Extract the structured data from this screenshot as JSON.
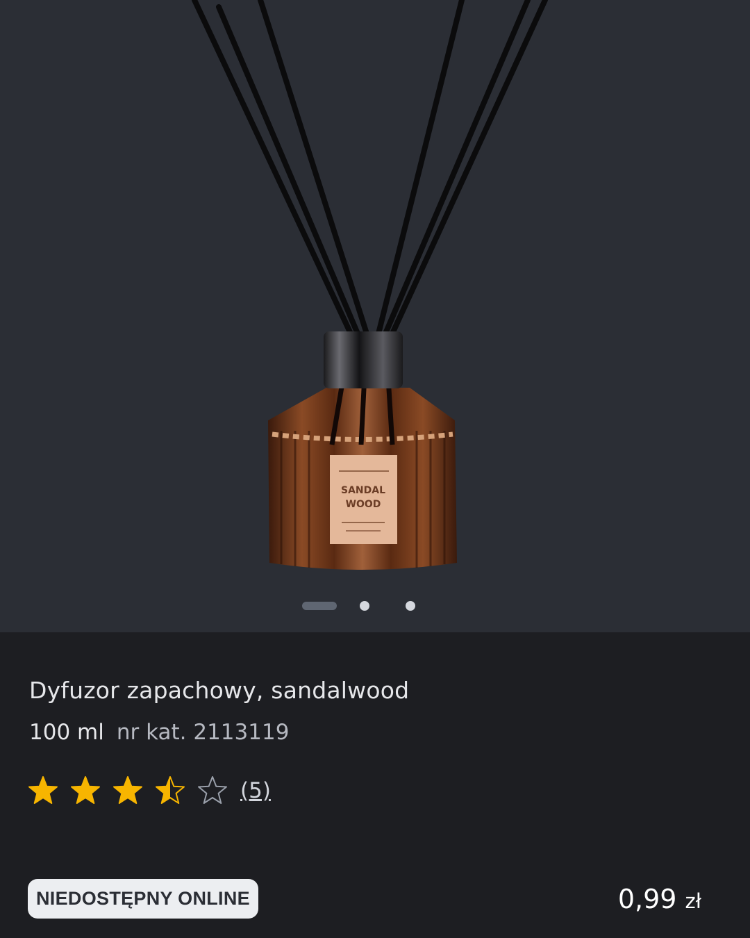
{
  "product": {
    "name": "Dyfuzor zapachowy, sandalwood",
    "size": "100 ml",
    "catalog": "nr kat. 2113119",
    "price_amount": "0,99",
    "price_currency": "zł",
    "availability": "NIEDOSTĘPNY ONLINE"
  },
  "rating": {
    "value": 3.5,
    "max": 5,
    "count": "(5)",
    "star_color": "#f7b500"
  },
  "gallery": {
    "image_count": 3,
    "active_index": 0,
    "image_label": {
      "line1": "SANDAL",
      "line2": "WOOD"
    }
  }
}
